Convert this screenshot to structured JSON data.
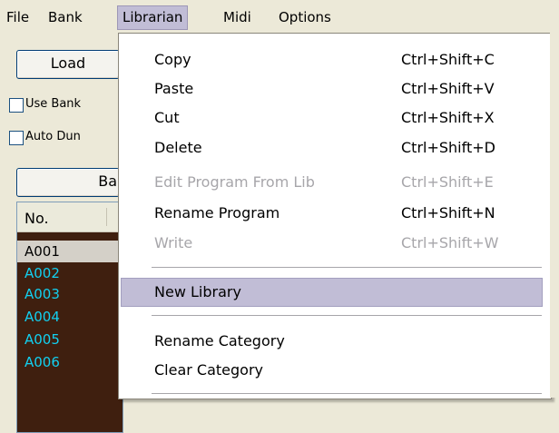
{
  "menubar": {
    "items": [
      {
        "label": "File",
        "active": false
      },
      {
        "label": "Bank",
        "active": false
      },
      {
        "label": "Librarian",
        "active": true
      },
      {
        "label": "Midi",
        "active": false
      },
      {
        "label": "Options",
        "active": false
      }
    ]
  },
  "background": {
    "load_button": "Load",
    "use_bank_checkbox": "Use Bank",
    "auto_dump_checkbox": "Auto Dun",
    "bank_button": "Ba",
    "list": {
      "header": "No.",
      "rows": [
        "A001",
        "A002",
        "A003",
        "A004",
        "A005",
        "A006"
      ]
    }
  },
  "librarian_menu": {
    "items": [
      {
        "label": "Copy",
        "shortcut": "Ctrl+Shift+C",
        "enabled": true
      },
      {
        "label": "Paste",
        "shortcut": "Ctrl+Shift+V",
        "enabled": true
      },
      {
        "label": "Cut",
        "shortcut": "Ctrl+Shift+X",
        "enabled": true
      },
      {
        "label": "Delete",
        "shortcut": "Ctrl+Shift+D",
        "enabled": true
      },
      {
        "label": "Edit Program From Lib",
        "shortcut": "Ctrl+Shift+E",
        "enabled": false
      },
      {
        "label": "Rename Program",
        "shortcut": "Ctrl+Shift+N",
        "enabled": true
      },
      {
        "label": "Write",
        "shortcut": "Ctrl+Shift+W",
        "enabled": false
      },
      {
        "label": "New Library",
        "shortcut": "",
        "enabled": true,
        "highlighted": true
      },
      {
        "label": "Rename Category",
        "shortcut": "",
        "enabled": true
      },
      {
        "label": "Clear Category",
        "shortcut": "",
        "enabled": true
      }
    ]
  },
  "colors": {
    "menu_highlight": "#c1bdd6",
    "list_background": "#3f1f0f",
    "list_text": "#12d0f0",
    "disabled_text": "#a7a6aa"
  }
}
